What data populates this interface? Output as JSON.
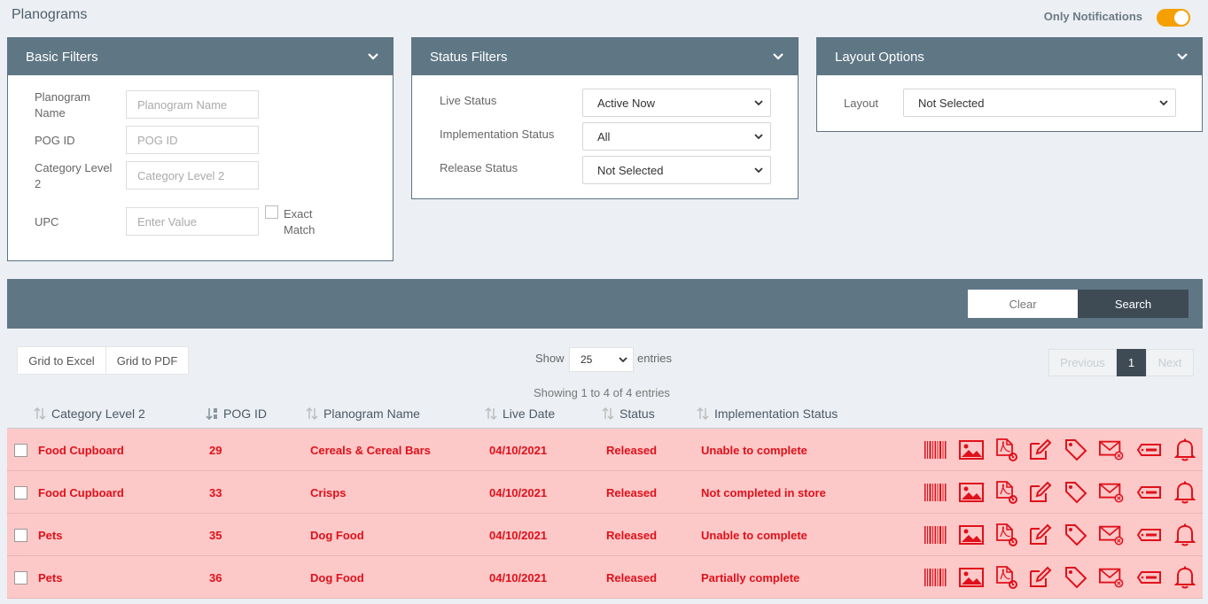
{
  "page": {
    "title": "Planograms"
  },
  "header": {
    "only_notifications_label": "Only Notifications",
    "toggle_on": true
  },
  "colors": {
    "accent": "#f5a000",
    "panel_header": "#5f7785",
    "row_highlight": "#fcc8c8",
    "alert_text": "#e0101a"
  },
  "basic_filters": {
    "title": "Basic Filters",
    "planogram_name_label": "Planogram Name",
    "planogram_name_placeholder": "Planogram Name",
    "pog_id_label": "POG ID",
    "pog_id_placeholder": "POG ID",
    "category_label": "Category Level 2",
    "category_placeholder": "Category Level 2",
    "upc_label": "UPC",
    "upc_placeholder": "Enter Value",
    "exact_match_label": "Exact Match"
  },
  "status_filters": {
    "title": "Status Filters",
    "live_status_label": "Live Status",
    "live_status_value": "Active Now",
    "implementation_status_label": "Implementation Status",
    "implementation_status_value": "All",
    "release_status_label": "Release Status",
    "release_status_value": "Not Selected"
  },
  "layout_options": {
    "title": "Layout Options",
    "layout_label": "Layout",
    "layout_value": "Not Selected"
  },
  "actions": {
    "clear": "Clear",
    "search": "Search"
  },
  "grid": {
    "to_excel": "Grid to Excel",
    "to_pdf": "Grid to PDF",
    "show_label": "Show",
    "entries_value": "25",
    "entries_label": "entries",
    "showing_text": "Showing 1 to 4 of 4 entries",
    "pager": {
      "previous": "Previous",
      "current": "1",
      "next": "Next"
    },
    "columns": [
      "Category Level 2",
      "POG ID",
      "Planogram Name",
      "Live Date",
      "Status",
      "Implementation Status"
    ],
    "rows": [
      {
        "category": "Food Cupboard",
        "pog_id": "29",
        "name": "Cereals & Cereal Bars",
        "live_date": "04/10/2021",
        "status": "Released",
        "impl": "Unable to complete"
      },
      {
        "category": "Food Cupboard",
        "pog_id": "33",
        "name": "Crisps",
        "live_date": "04/10/2021",
        "status": "Released",
        "impl": "Not completed in store"
      },
      {
        "category": "Pets",
        "pog_id": "35",
        "name": "Dog Food",
        "live_date": "04/10/2021",
        "status": "Released",
        "impl": "Unable to complete"
      },
      {
        "category": "Pets",
        "pog_id": "36",
        "name": "Dog Food",
        "live_date": "04/10/2021",
        "status": "Released",
        "impl": "Partially complete"
      }
    ],
    "row_icons": [
      "barcode-icon",
      "image-icon",
      "pdf-settings-icon",
      "edit-icon",
      "tag-icon",
      "email-icon",
      "ticket-icon",
      "bell-icon"
    ]
  }
}
